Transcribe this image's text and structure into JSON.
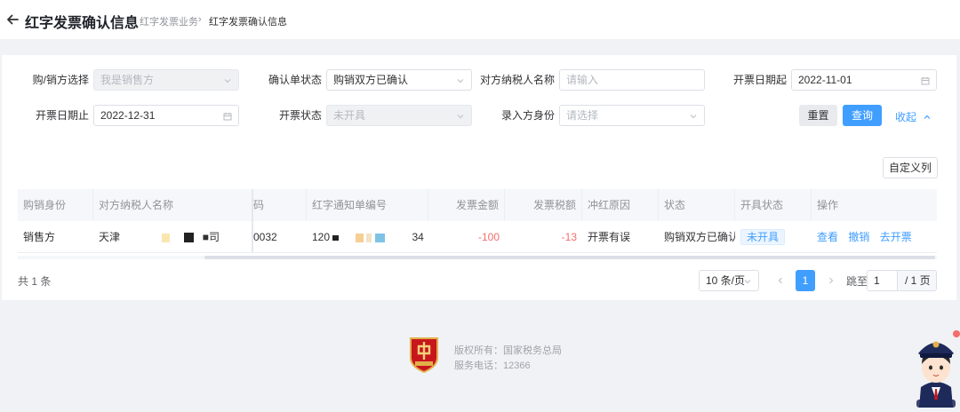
{
  "header": {
    "title": "红字发票确认信息",
    "breadcrumb": [
      "红字发票业务",
      "红字发票确认信息"
    ]
  },
  "filters": {
    "buyer_seller_label": "购/销方选择",
    "buyer_seller_value": "我是销售方",
    "confirm_status_label": "确认单状态",
    "confirm_status_value": "购销双方已确认",
    "counterparty_label": "对方纳税人名称",
    "counterparty_placeholder": "请输入",
    "date_from_label": "开票日期起",
    "date_from_value": "2022-11-01",
    "date_to_label": "开票日期止",
    "date_to_value": "2022-12-31",
    "issue_status_label": "开票状态",
    "issue_status_value": "未开具",
    "entry_role_label": "录入方身份",
    "entry_role_placeholder": "请选择",
    "reset_label": "重置",
    "query_label": "查询",
    "collapse_label": "收起"
  },
  "customize_columns_label": "自定义列",
  "table": {
    "headers": [
      "购销身份",
      "对方纳税人名称",
      "码",
      "红字通知单编号",
      "发票金额",
      "发票税额",
      "冲红原因",
      "状态",
      "开具状态",
      "操作"
    ],
    "rows": [
      {
        "role": "销售方",
        "counterparty_prefix": "天津",
        "counterparty_suffix": "司",
        "tax_id_tail": "0032",
        "notice_prefix": "120",
        "notice_suffix": "34",
        "amount": "-100",
        "tax": "-13",
        "reason": "开票有误",
        "status": "购销双方已确认",
        "issue_status": "未开具",
        "actions": [
          "查看",
          "撤销",
          "去开票"
        ]
      }
    ]
  },
  "pagination": {
    "total": "共 1 条",
    "page_size": "10 条/页",
    "current_page": "1",
    "jump_label": "跳至",
    "jump_value": "1",
    "total_pages": "/ 1 页"
  },
  "footer": {
    "copyright": "版权所有：国家税务总局",
    "phone": "服务电话：12366"
  },
  "colors": {
    "primary": "#409eff",
    "negative_amount": "#f56c6c",
    "page_background": "#f0f2f5",
    "emblem_red": "#c8161d",
    "mascot_navy": "#1e2a5a"
  },
  "icons": [
    "back-arrow-icon",
    "chevron-down-icon",
    "calendar-icon",
    "chevron-up-icon",
    "chevron-left-icon",
    "chevron-right-icon",
    "tax-emblem-icon",
    "mascot-icon"
  ]
}
